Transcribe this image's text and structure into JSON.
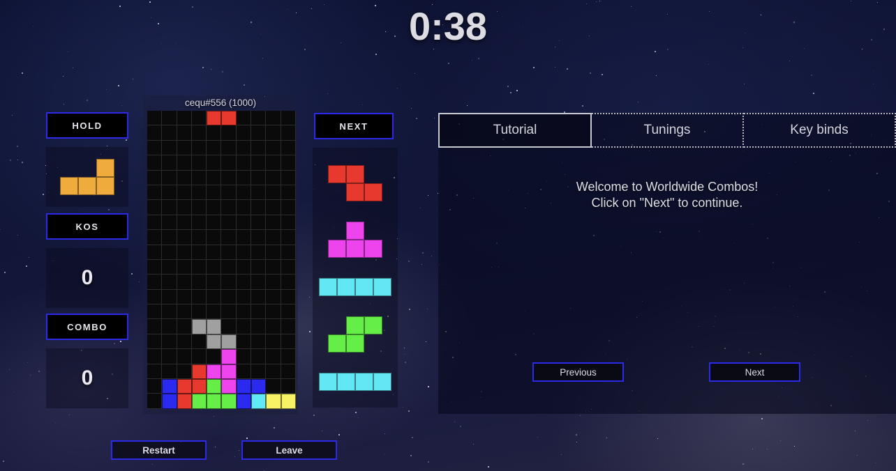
{
  "timer": "0:38",
  "colors": {
    "I": "#62e8f5",
    "O": "#f7f265",
    "T": "#ee44ee",
    "S": "#66ee48",
    "Z": "#e8392e",
    "J": "#2b2bf0",
    "L": "#f0ab3d",
    "ghost": "#a0a0a0",
    "empty": "#0a0a0a",
    "accent_border": "#2a2ae8",
    "text": "#dedee6"
  },
  "sidebar": {
    "hold": {
      "label": "HOLD",
      "piece": "L",
      "piece_color": "#f0ab3d"
    },
    "kos": {
      "label": "KOS",
      "value": "0"
    },
    "combo": {
      "label": "COMBO",
      "value": "0"
    }
  },
  "board": {
    "player_name": "cequ#556 (1000)",
    "columns": 10,
    "rows": 20,
    "grid": [
      [
        "",
        "",
        "",
        "",
        "Z",
        "Z",
        "",
        "",
        "",
        ""
      ],
      [
        "",
        "",
        "",
        "",
        "",
        "",
        "",
        "",
        "",
        ""
      ],
      [
        "",
        "",
        "",
        "",
        "",
        "",
        "",
        "",
        "",
        ""
      ],
      [
        "",
        "",
        "",
        "",
        "",
        "",
        "",
        "",
        "",
        ""
      ],
      [
        "",
        "",
        "",
        "",
        "",
        "",
        "",
        "",
        "",
        ""
      ],
      [
        "",
        "",
        "",
        "",
        "",
        "",
        "",
        "",
        "",
        ""
      ],
      [
        "",
        "",
        "",
        "",
        "",
        "",
        "",
        "",
        "",
        ""
      ],
      [
        "",
        "",
        "",
        "",
        "",
        "",
        "",
        "",
        "",
        ""
      ],
      [
        "",
        "",
        "",
        "",
        "",
        "",
        "",
        "",
        "",
        ""
      ],
      [
        "",
        "",
        "",
        "",
        "",
        "",
        "",
        "",
        "",
        ""
      ],
      [
        "",
        "",
        "",
        "",
        "",
        "",
        "",
        "",
        "",
        ""
      ],
      [
        "",
        "",
        "",
        "",
        "",
        "",
        "",
        "",
        "",
        ""
      ],
      [
        "",
        "",
        "",
        "",
        "",
        "",
        "",
        "",
        "",
        ""
      ],
      [
        "",
        "",
        "",
        "",
        "",
        "",
        "",
        "",
        "",
        ""
      ],
      [
        "",
        "",
        "",
        "G",
        "G",
        "",
        "",
        "",
        "",
        ""
      ],
      [
        "",
        "",
        "",
        "",
        "G",
        "G",
        "",
        "",
        "",
        ""
      ],
      [
        "",
        "",
        "",
        "",
        "",
        "T",
        "",
        "",
        "",
        ""
      ],
      [
        "",
        "",
        "",
        "Z",
        "T",
        "T",
        "",
        "",
        "",
        ""
      ],
      [
        "",
        "J",
        "Z",
        "Z",
        "S",
        "T",
        "J",
        "J",
        "",
        ""
      ],
      [
        "",
        "J",
        "Z",
        "S",
        "S",
        "S",
        "J",
        "I",
        "O",
        "O"
      ]
    ]
  },
  "next": {
    "label": "NEXT",
    "queue": [
      {
        "piece": "Z",
        "color": "#e8392e",
        "cells": [
          [
            1,
            1,
            0
          ],
          [
            0,
            1,
            1
          ]
        ]
      },
      {
        "piece": "T",
        "color": "#ee44ee",
        "cells": [
          [
            0,
            1,
            0
          ],
          [
            1,
            1,
            1
          ]
        ]
      },
      {
        "piece": "I",
        "color": "#62e8f5",
        "cells": [
          [
            1,
            1,
            1,
            1
          ]
        ]
      },
      {
        "piece": "S",
        "color": "#66ee48",
        "cells": [
          [
            0,
            1,
            1
          ],
          [
            1,
            1,
            0
          ]
        ]
      },
      {
        "piece": "I",
        "color": "#62e8f5",
        "cells": [
          [
            1,
            1,
            1,
            1
          ]
        ]
      }
    ]
  },
  "right_panel": {
    "tabs": [
      {
        "label": "Tutorial",
        "active": true
      },
      {
        "label": "Tunings",
        "active": false
      },
      {
        "label": "Key binds",
        "active": false
      }
    ],
    "content_line1": "Welcome to Worldwide Combos!",
    "content_line2": "Click on \"Next\" to continue.",
    "previous_label": "Previous",
    "next_label": "Next"
  },
  "bottom": {
    "restart_label": "Restart",
    "leave_label": "Leave"
  }
}
